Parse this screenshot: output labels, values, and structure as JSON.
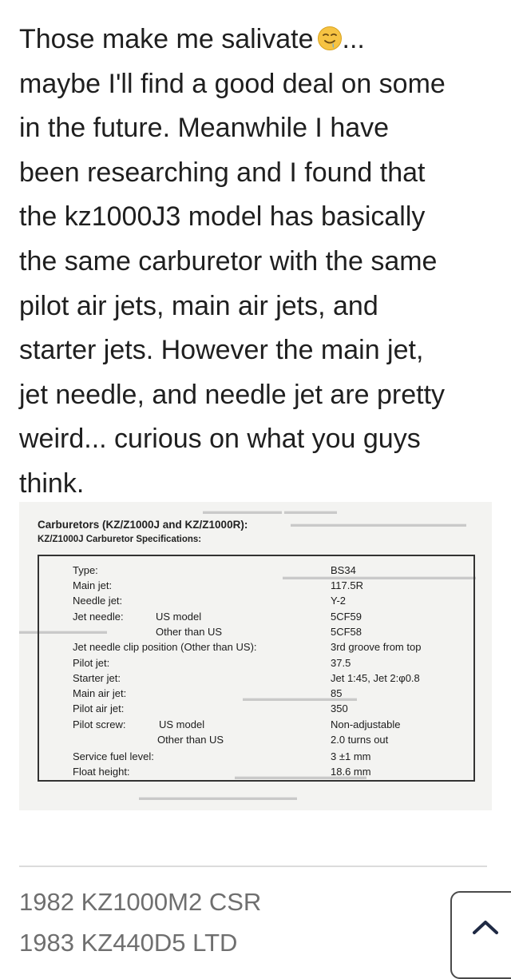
{
  "post": {
    "lines": [
      "Those make me salivate",
      "maybe I'll find a good deal on some",
      "in the future. Meanwhile I have",
      "been researching and I found that",
      "the kz1000J3 model has basically",
      "the same carburetor with the same",
      "pilot air jets, main air jets, and",
      "starter jets. However the main jet,",
      "jet needle, and needle jet are pretty",
      "weird... curious on what you guys",
      "think."
    ],
    "first_line_suffix": "...",
    "emoji_icon": "drooling-face-icon"
  },
  "spec_image": {
    "title": "Carburetors (KZ/Z1000J and KZ/Z1000R):",
    "subtitle": "KZ/Z1000J Carburetor Specifications:",
    "rows": {
      "type_label": "Type:",
      "type_value": "BS34",
      "main_jet_label": "Main jet:",
      "main_jet_value": "117.5R",
      "needle_jet_label": "Needle jet:",
      "needle_jet_value": "Y-2",
      "jet_needle_label": "Jet needle:",
      "jet_needle_us": "US model",
      "jet_needle_us_value": "5CF59",
      "jet_needle_other": "Other than US",
      "jet_needle_other_value": "5CF58",
      "clip_label": "Jet needle clip position (Other than US):",
      "clip_value": "3rd groove from top",
      "pilot_jet_label": "Pilot jet:",
      "pilot_jet_value": "37.5",
      "starter_jet_label": "Starter jet:",
      "starter_jet_value": "Jet 1:45, Jet 2:φ0.8",
      "main_air_jet_label": "Main air jet:",
      "main_air_jet_value": "85",
      "pilot_air_jet_label": "Pilot air jet:",
      "pilot_air_jet_value": "350",
      "pilot_screw_label": "Pilot screw:",
      "pilot_screw_us": "US model",
      "pilot_screw_us_value": "Non-adjustable",
      "pilot_screw_other": "Other than US",
      "pilot_screw_other_value": "2.0 turns out",
      "fuel_level_label": "Service fuel level:",
      "fuel_level_value": "3 ±1 mm",
      "float_height_label": "Float height:",
      "float_height_value": "18.6 mm"
    }
  },
  "signature": {
    "lines": [
      "1982 KZ1000M2 CSR",
      "1983 KZ440D5 LTD"
    ]
  },
  "scroll_top": {
    "icon": "chevron-up-icon"
  },
  "colors": {
    "text": "#1f1f1f",
    "signature": "#6f6f6f",
    "divider": "#dcdcdc",
    "emoji_face": "#f6c343",
    "emoji_drool": "#5fa8e6"
  }
}
